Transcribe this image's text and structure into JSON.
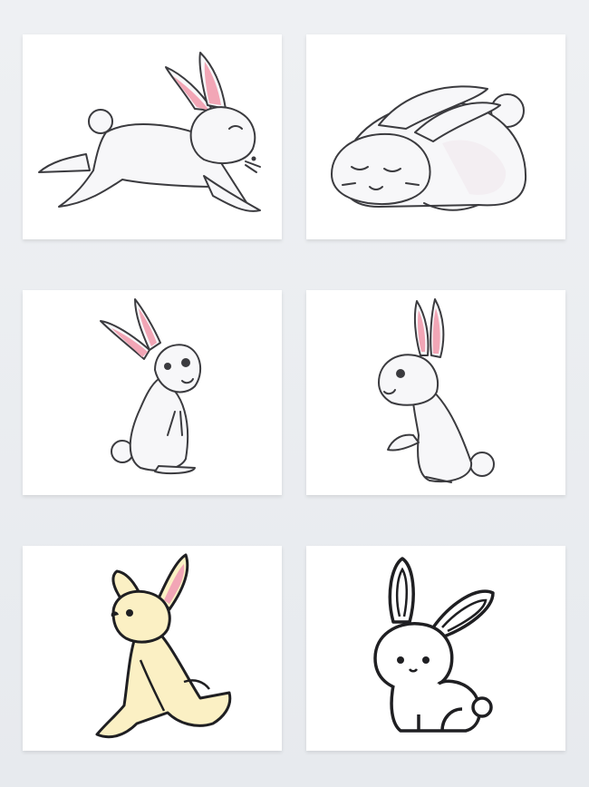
{
  "colors": {
    "background": "#eceff2",
    "card": "#ffffff",
    "outline": "#3b3b3f",
    "fur_white": "#f7f7f9",
    "inner_ear_pink": "#f2a6b6",
    "fur_cream": "#fbf0c4"
  },
  "cards": [
    {
      "icon": "leaping-rabbit-icon"
    },
    {
      "icon": "sleeping-rabbit-icon"
    },
    {
      "icon": "sitting-rabbit-icon"
    },
    {
      "icon": "standing-rabbit-icon"
    },
    {
      "icon": "yellow-rabbit-icon"
    },
    {
      "icon": "outline-rabbit-icon"
    }
  ]
}
